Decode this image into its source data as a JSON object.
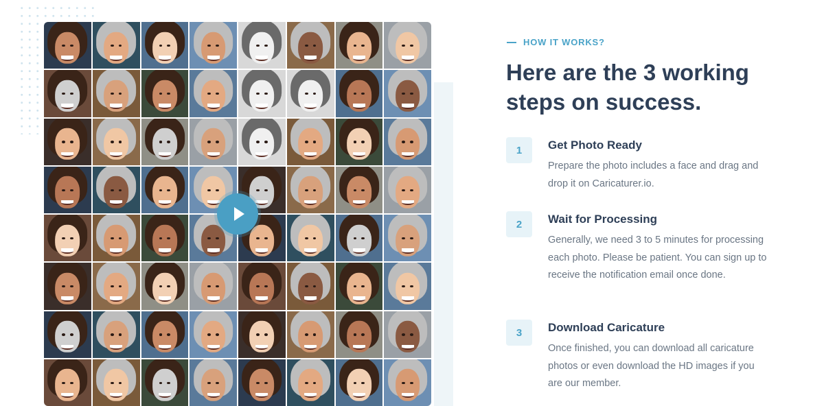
{
  "section": {
    "eyebrow": "HOW IT WORKS?",
    "headline": "Here are the 3 working steps on success."
  },
  "steps": [
    {
      "number": "1",
      "title": "Get Photo Ready",
      "description": "Prepare the photo includes a face and drag and drop it on Caricaturer.io."
    },
    {
      "number": "2",
      "title": "Wait for Processing",
      "description": "Generally, we need 3 to 5 minutes for processing each photo. Please be patient. You can sign up to receive the notification email once done."
    },
    {
      "number": "3",
      "title": "Download Caricature",
      "description": "Once finished, you can download all caricature photos or even download the HD images if you are our member."
    }
  ],
  "video": {
    "icon": "play-icon"
  },
  "colors": {
    "accent": "#4aa3c8",
    "heading": "#2e3f57",
    "body": "#6a7684",
    "badge_bg": "#e7f3f8"
  }
}
